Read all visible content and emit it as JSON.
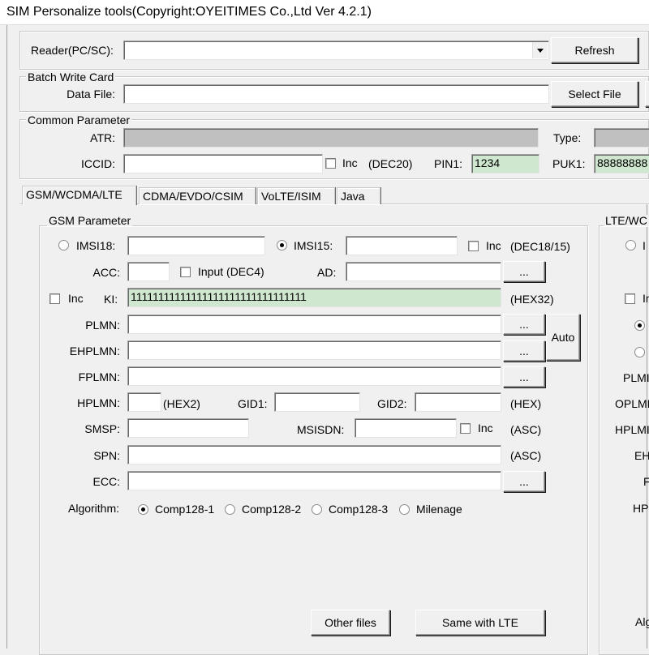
{
  "window": {
    "title": "SIM Personalize tools(Copyright:OYEITIMES Co.,Ltd Ver 4.2.1)"
  },
  "reader": {
    "label": "Reader(PC/SC):",
    "value": "",
    "refresh_label": "Refresh"
  },
  "batch": {
    "group_title": "Batch Write Card",
    "data_file_label": "Data File:",
    "data_file_value": "",
    "select_file_label": "Select File"
  },
  "common": {
    "group_title": "Common Parameter",
    "atr_label": "ATR:",
    "atr_value": "",
    "type_label": "Type:",
    "type_value": "",
    "iccid_label": "ICCID:",
    "iccid_value": "",
    "inc_label": "Inc",
    "inc_hint": "(DEC20)",
    "pin1_label": "PIN1:",
    "pin1_value": "1234",
    "puk1_label": "PUK1:",
    "puk1_value": "88888888"
  },
  "tabs": [
    "GSM/WCDMA/LTE",
    "CDMA/EVDO/CSIM",
    "VoLTE/ISIM",
    "Java"
  ],
  "gsm": {
    "group_title": "GSM Parameter",
    "imsi18_label": "IMSI18:",
    "imsi18_value": "",
    "imsi15_label": "IMSI15:",
    "imsi15_value": "",
    "inc_label": "Inc",
    "inc_hint": "(DEC18/15)",
    "acc_label": "ACC:",
    "acc_value": "",
    "input_label": "Input (DEC4)",
    "ad_label": "AD:",
    "ad_value": "",
    "ki_inc_label": "Inc",
    "ki_label": "KI:",
    "ki_value": "11111111111111111111111111111111",
    "ki_hint": "(HEX32)",
    "plmn_label": "PLMN:",
    "ehplmn_label": "EHPLMN:",
    "fplmn_label": "FPLMN:",
    "auto_label": "Auto",
    "browse_label": "...",
    "hplmn_label": "HPLMN:",
    "hplmn_hint": "(HEX2)",
    "gid1_label": "GID1:",
    "gid2_label": "GID2:",
    "gid_hint": "(HEX)",
    "smsp_label": "SMSP:",
    "msisdn_label": "MSISDN:",
    "msisdn_inc_label": "Inc",
    "msisdn_hint": "(ASC)",
    "spn_label": "SPN:",
    "spn_hint": "(ASC)",
    "ecc_label": "ECC:",
    "algorithm_label": "Algorithm:",
    "algorithms": [
      "Comp128-1",
      "Comp128-2",
      "Comp128-3",
      "Milenage"
    ],
    "other_files_label": "Other files",
    "same_lte_label": "Same with LTE"
  },
  "lte": {
    "group_title": "LTE/WC",
    "row_labels": [
      "I",
      "In",
      "PLMI",
      "OPLMI",
      "HPLMI",
      "EH",
      "F",
      "HP",
      "Alg"
    ]
  }
}
